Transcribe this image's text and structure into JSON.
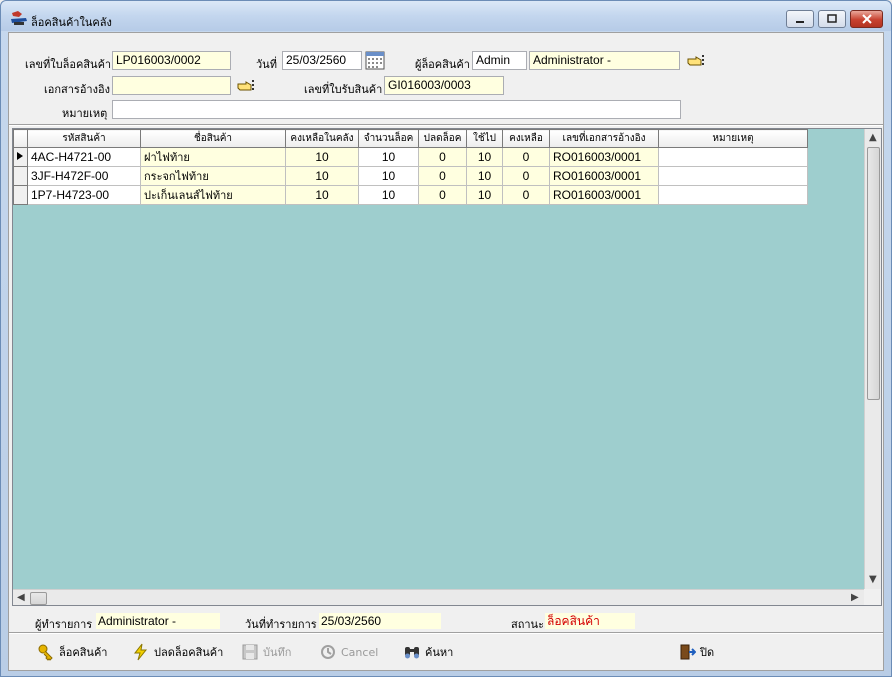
{
  "window": {
    "title": "ล็อคสินค้าในคลัง"
  },
  "form": {
    "lock_no_label": "เลขที่ใบล็อคสินค้า",
    "lock_no": "LP016003/0002",
    "date_label": "วันที่",
    "date": "25/03/2560",
    "locker_label": "ผู้ล็อคสินค้า",
    "locker_code": "Admin",
    "locker_name": "Administrator -",
    "ref_doc_label": "เอกสารอ้างอิง",
    "ref_doc": "",
    "receipt_no_label": "เลขที่ใบรับสินค้า",
    "receipt_no": "GI016003/0003",
    "note_label": "หมายเหตุ",
    "note": ""
  },
  "grid": {
    "columns": [
      "รหัสสินค้า",
      "ชื่อสินค้า",
      "คงเหลือในคลัง",
      "จำนวนล็อค",
      "ปลดล็อค",
      "ใช้ไป",
      "คงเหลือ",
      "เลขที่เอกสารอ้างอิง",
      "หมายเหตุ"
    ],
    "rows": [
      {
        "code": "4AC-H4721-00",
        "name": "ฝาไฟท้าย",
        "stock": "10",
        "lock_qty": "10",
        "unlock": "0",
        "used": "10",
        "remain": "0",
        "ref": "RO016003/0001",
        "note": ""
      },
      {
        "code": "3JF-H472F-00",
        "name": "กระจกไฟท้าย",
        "stock": "10",
        "lock_qty": "10",
        "unlock": "0",
        "used": "10",
        "remain": "0",
        "ref": "RO016003/0001",
        "note": ""
      },
      {
        "code": "1P7-H4723-00",
        "name": "ปะเก็นเลนส์ไฟท้าย",
        "stock": "10",
        "lock_qty": "10",
        "unlock": "0",
        "used": "10",
        "remain": "0",
        "ref": "RO016003/0001",
        "note": ""
      }
    ]
  },
  "status": {
    "operator_label": "ผู้ทำรายการ",
    "operator": "Administrator -",
    "op_date_label": "วันที่ทำรายการ",
    "op_date": "25/03/2560",
    "state_label": "สถานะ",
    "state": "ล็อคสินค้า",
    "state_color": "#d40000"
  },
  "toolbar": {
    "lock": "ล็อคสินค้า",
    "unlock": "ปลดล็อคสินค้า",
    "save": "บันทึก",
    "cancel": "Cancel",
    "search": "ค้นหา",
    "close": "ปิด"
  }
}
